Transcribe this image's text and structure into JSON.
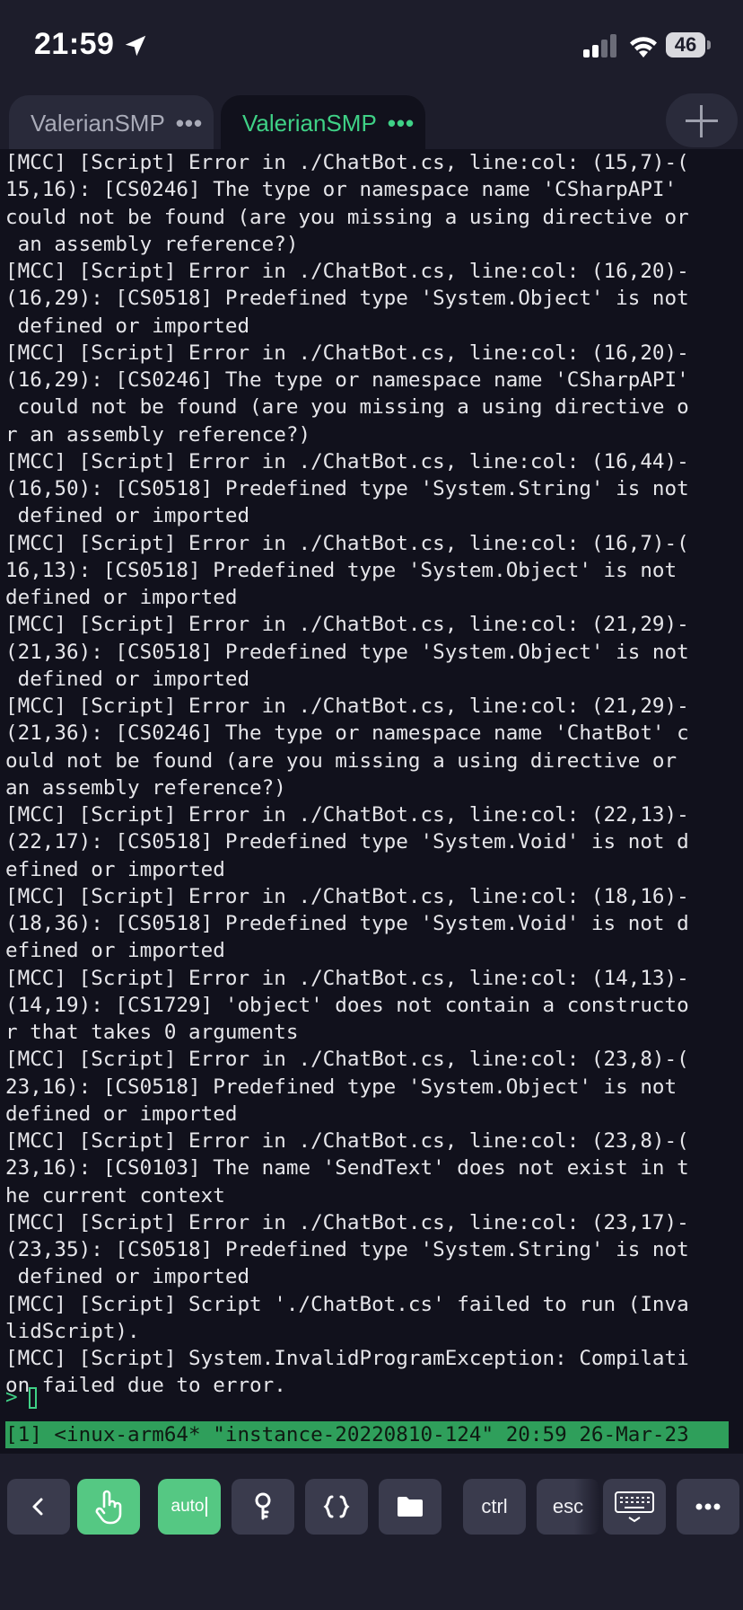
{
  "status_bar": {
    "time": "21:59",
    "battery": "46"
  },
  "tabs": [
    {
      "label": "ValerianSMP",
      "dots": "•••",
      "active": false
    },
    {
      "label": "ValerianSMP",
      "dots": "•••",
      "active": true
    }
  ],
  "terminal": {
    "lines": [
      "[MCC] [Script] Error in ./ChatBot.cs, line:col: (15,7)-(",
      "15,16): [CS0246] The type or namespace name 'CSharpAPI'",
      "could not be found (are you missing a using directive or",
      " an assembly reference?)",
      "[MCC] [Script] Error in ./ChatBot.cs, line:col: (16,20)-",
      "(16,29): [CS0518] Predefined type 'System.Object' is not",
      " defined or imported",
      "[MCC] [Script] Error in ./ChatBot.cs, line:col: (16,20)-",
      "(16,29): [CS0246] The type or namespace name 'CSharpAPI'",
      " could not be found (are you missing a using directive o",
      "r an assembly reference?)",
      "[MCC] [Script] Error in ./ChatBot.cs, line:col: (16,44)-",
      "(16,50): [CS0518] Predefined type 'System.String' is not",
      " defined or imported",
      "[MCC] [Script] Error in ./ChatBot.cs, line:col: (16,7)-(",
      "16,13): [CS0518] Predefined type 'System.Object' is not",
      "defined or imported",
      "[MCC] [Script] Error in ./ChatBot.cs, line:col: (21,29)-",
      "(21,36): [CS0518] Predefined type 'System.Object' is not",
      " defined or imported",
      "[MCC] [Script] Error in ./ChatBot.cs, line:col: (21,29)-",
      "(21,36): [CS0246] The type or namespace name 'ChatBot' c",
      "ould not be found (are you missing a using directive or",
      "an assembly reference?)",
      "[MCC] [Script] Error in ./ChatBot.cs, line:col: (22,13)-",
      "(22,17): [CS0518] Predefined type 'System.Void' is not d",
      "efined or imported",
      "[MCC] [Script] Error in ./ChatBot.cs, line:col: (18,16)-",
      "(18,36): [CS0518] Predefined type 'System.Void' is not d",
      "efined or imported",
      "[MCC] [Script] Error in ./ChatBot.cs, line:col: (14,13)-",
      "(14,19): [CS1729] 'object' does not contain a constructo",
      "r that takes 0 arguments",
      "[MCC] [Script] Error in ./ChatBot.cs, line:col: (23,8)-(",
      "23,16): [CS0518] Predefined type 'System.Object' is not",
      "defined or imported",
      "[MCC] [Script] Error in ./ChatBot.cs, line:col: (23,8)-(",
      "23,16): [CS0103] The name 'SendText' does not exist in t",
      "he current context",
      "[MCC] [Script] Error in ./ChatBot.cs, line:col: (23,17)-",
      "(23,35): [CS0518] Predefined type 'System.String' is not",
      " defined or imported",
      "[MCC] [Script] Script './ChatBot.cs' failed to run (Inva",
      "lidScript).",
      "[MCC] [Script] System.InvalidProgramException: Compilati",
      "on failed due to error."
    ],
    "prompt": ">",
    "tmux_status": "[1] <inux-arm64* \"instance-20220810-124\" 20:59 26-Mar-23"
  },
  "toolbar": {
    "keys": [
      {
        "name": "back-key",
        "label": "",
        "icon": "chevron-left-icon"
      },
      {
        "name": "touch-key",
        "label": "",
        "icon": "hand-pointer-icon"
      },
      {
        "name": "auto-key",
        "label": "auto",
        "icon": ""
      },
      {
        "name": "key-key",
        "label": "",
        "icon": "key-icon"
      },
      {
        "name": "braces-key",
        "label": "",
        "icon": "braces-icon"
      },
      {
        "name": "folder-key",
        "label": "",
        "icon": "folder-icon"
      },
      {
        "name": "ctrl-key",
        "label": "ctrl",
        "icon": ""
      },
      {
        "name": "esc-key",
        "label": "esc",
        "icon": ""
      },
      {
        "name": "keyboard-key",
        "label": "",
        "icon": "keyboard-icon"
      },
      {
        "name": "more-key",
        "label": "",
        "icon": "more-icon"
      }
    ],
    "accent_color": "#55c883"
  },
  "colors": {
    "terminal_bg": "#11111c",
    "tab_active_text": "#3fd186",
    "tmux_bar": "#2f9f5b"
  }
}
